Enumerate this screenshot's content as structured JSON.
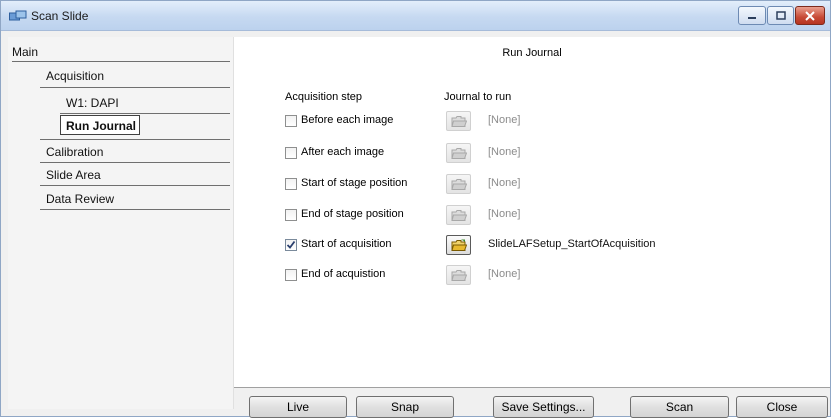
{
  "window": {
    "title": "Scan Slide"
  },
  "nav": {
    "main": "Main",
    "acquisition": "Acquisition",
    "w1": "W1: DAPI",
    "run_journal": "Run Journal",
    "calibration": "Calibration",
    "slide_area": "Slide Area",
    "data_review": "Data Review"
  },
  "panel": {
    "title": "Run Journal",
    "col_step": "Acquisition step",
    "col_journal": "Journal to run",
    "rows": [
      {
        "label": "Before each image",
        "checked": false,
        "journal": "[None]"
      },
      {
        "label": "After each image",
        "checked": false,
        "journal": "[None]"
      },
      {
        "label": "Start of stage position",
        "checked": false,
        "journal": "[None]"
      },
      {
        "label": "End of stage position",
        "checked": false,
        "journal": "[None]"
      },
      {
        "label": "Start of acquisition",
        "checked": true,
        "journal": "SlideLAFSetup_StartOfAcquisition"
      },
      {
        "label": "End of acquistion",
        "checked": false,
        "journal": "[None]"
      }
    ]
  },
  "buttons": {
    "live": "Live",
    "snap": "Snap",
    "save_settings": "Save Settings...",
    "scan": "Scan",
    "close": "Close"
  }
}
